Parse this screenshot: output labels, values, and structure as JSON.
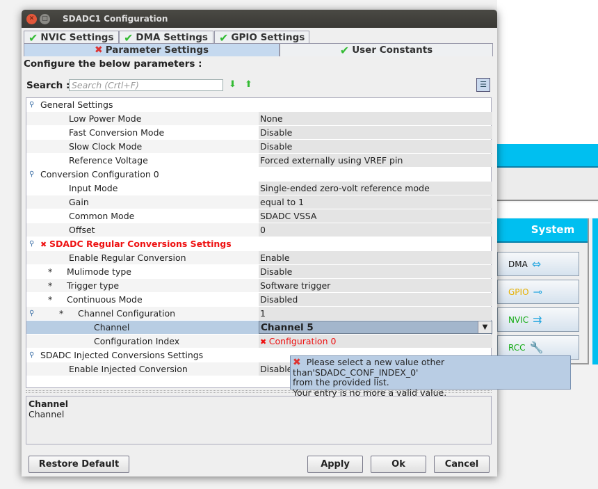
{
  "background": {
    "system_title": "System",
    "buttons": [
      {
        "label": "DMA",
        "color": "#111"
      },
      {
        "label": "GPIO",
        "color": "#e6b000"
      },
      {
        "label": "NVIC",
        "color": "#1a1"
      },
      {
        "label": "RCC",
        "color": "#1a1"
      }
    ]
  },
  "window": {
    "title": "SDADC1 Configuration"
  },
  "tabs": [
    {
      "label": "NVIC Settings",
      "status": "ok"
    },
    {
      "label": "DMA Settings",
      "status": "ok"
    },
    {
      "label": "GPIO Settings",
      "status": "ok"
    },
    {
      "label": "Parameter Settings",
      "status": "error"
    },
    {
      "label": "User Constants",
      "status": "ok"
    }
  ],
  "heading": "Configure the below parameters :",
  "search": {
    "label": "Search :",
    "placeholder": "Search (Crtl+F)"
  },
  "rows": [
    {
      "kind": "group",
      "name": "General Settings"
    },
    {
      "level": 1,
      "name": "Low Power Mode",
      "value": "None"
    },
    {
      "level": 1,
      "name": "Fast Conversion Mode",
      "value": "Disable"
    },
    {
      "level": 1,
      "name": "Slow Clock Mode",
      "value": "Disable"
    },
    {
      "level": 1,
      "name": "Reference Voltage",
      "value": "Forced externally using VREF pin"
    },
    {
      "kind": "group",
      "name": "Conversion Configuration 0"
    },
    {
      "level": 1,
      "name": "Input Mode",
      "value": "Single-ended zero-volt reference mode"
    },
    {
      "level": 1,
      "name": "Gain",
      "value": "equal to 1"
    },
    {
      "level": 1,
      "name": "Common Mode",
      "value": "SDADC VSSA"
    },
    {
      "level": 1,
      "name": "Offset",
      "value": "0"
    },
    {
      "kind": "group",
      "error": true,
      "name": "SDADC Regular Conversions Settings"
    },
    {
      "level": 1,
      "name": "Enable Regular Conversion",
      "value": "Enable"
    },
    {
      "level": 1,
      "star": true,
      "name": "Mulimode type",
      "value": "Disable"
    },
    {
      "level": 1,
      "star": true,
      "name": "Trigger type",
      "value": "Software trigger"
    },
    {
      "level": 1,
      "star": true,
      "name": "Continuous Mode",
      "value": "Disabled"
    },
    {
      "level": 2,
      "star": true,
      "expand": true,
      "name": "Channel Configuration",
      "value": "1"
    },
    {
      "level": 3,
      "name": "Channel",
      "value": "Channel 5",
      "selected": true
    },
    {
      "level": 3,
      "name": "Configuration Index",
      "value": "Configuration 0",
      "error": true
    },
    {
      "kind": "group",
      "name": "SDADC Injected Conversions Settings"
    },
    {
      "level": 1,
      "name": "Enable Injected Conversion",
      "value": "Disable"
    }
  ],
  "description": {
    "title": "Channel",
    "text": "Channel"
  },
  "tooltip": {
    "line1": "Please select a new value other than'SDADC_CONF_INDEX_0'",
    "line2": "from the provided list.",
    "line3": "Your entry is no more a valid value."
  },
  "buttons": {
    "restore": "Restore Default",
    "apply": "Apply",
    "ok": "Ok",
    "cancel": "Cancel"
  }
}
